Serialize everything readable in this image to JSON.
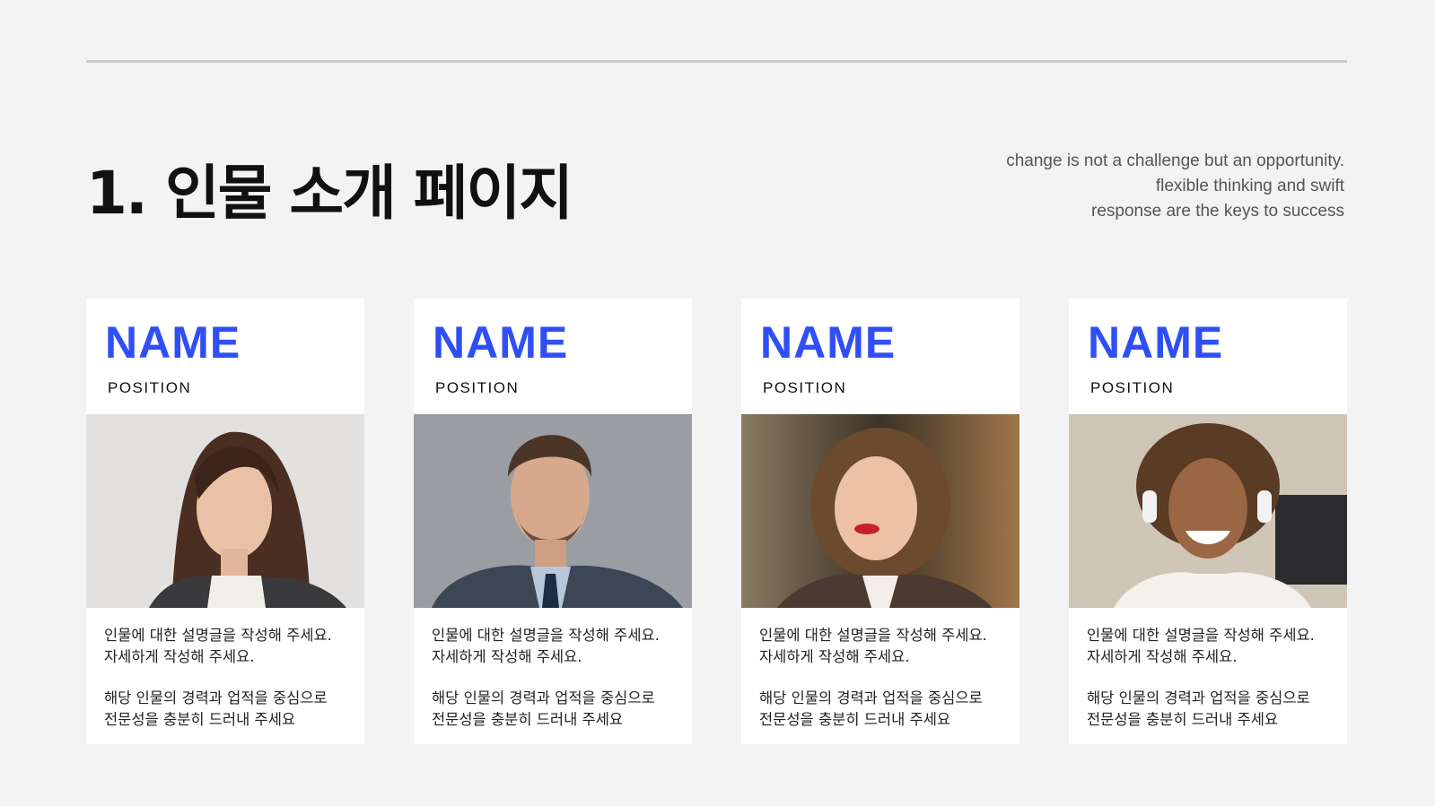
{
  "title": "1. 인물 소개 페이지",
  "quote": [
    "change is not a challenge but an opportunity.",
    "flexible thinking and swift",
    "response are the keys to success"
  ],
  "accent_color": "#2f4ff5",
  "cards": [
    {
      "name": "NAME",
      "position": "POSITION",
      "photo": "portrait-woman-long-hair",
      "desc1a": "인물에 대한 설명글을 작성해 주세요.",
      "desc1b": "자세하게 작성해 주세요.",
      "desc2a": "해당 인물의 경력과 업적을 중심으로",
      "desc2b": "전문성을 충분히 드러내 주세요"
    },
    {
      "name": "NAME",
      "position": "POSITION",
      "photo": "portrait-man-suit",
      "desc1a": "인물에 대한 설명글을 작성해 주세요.",
      "desc1b": "자세하게 작성해 주세요.",
      "desc2a": "해당 인물의 경력과 업적을 중심으로",
      "desc2b": "전문성을 충분히 드러내 주세요"
    },
    {
      "name": "NAME",
      "position": "POSITION",
      "photo": "portrait-woman-curly-hair",
      "desc1a": "인물에 대한 설명글을 작성해 주세요.",
      "desc1b": "자세하게 작성해 주세요.",
      "desc2a": "해당 인물의 경력과 업적을 중심으로",
      "desc2b": "전문성을 충분히 드러내 주세요"
    },
    {
      "name": "NAME",
      "position": "POSITION",
      "photo": "portrait-woman-headset",
      "desc1a": "인물에 대한 설명글을 작성해 주세요.",
      "desc1b": "자세하게 작성해 주세요.",
      "desc2a": "해당 인물의 경력과 업적을 중심으로",
      "desc2b": "전문성을 충분히 드러내 주세요"
    }
  ]
}
